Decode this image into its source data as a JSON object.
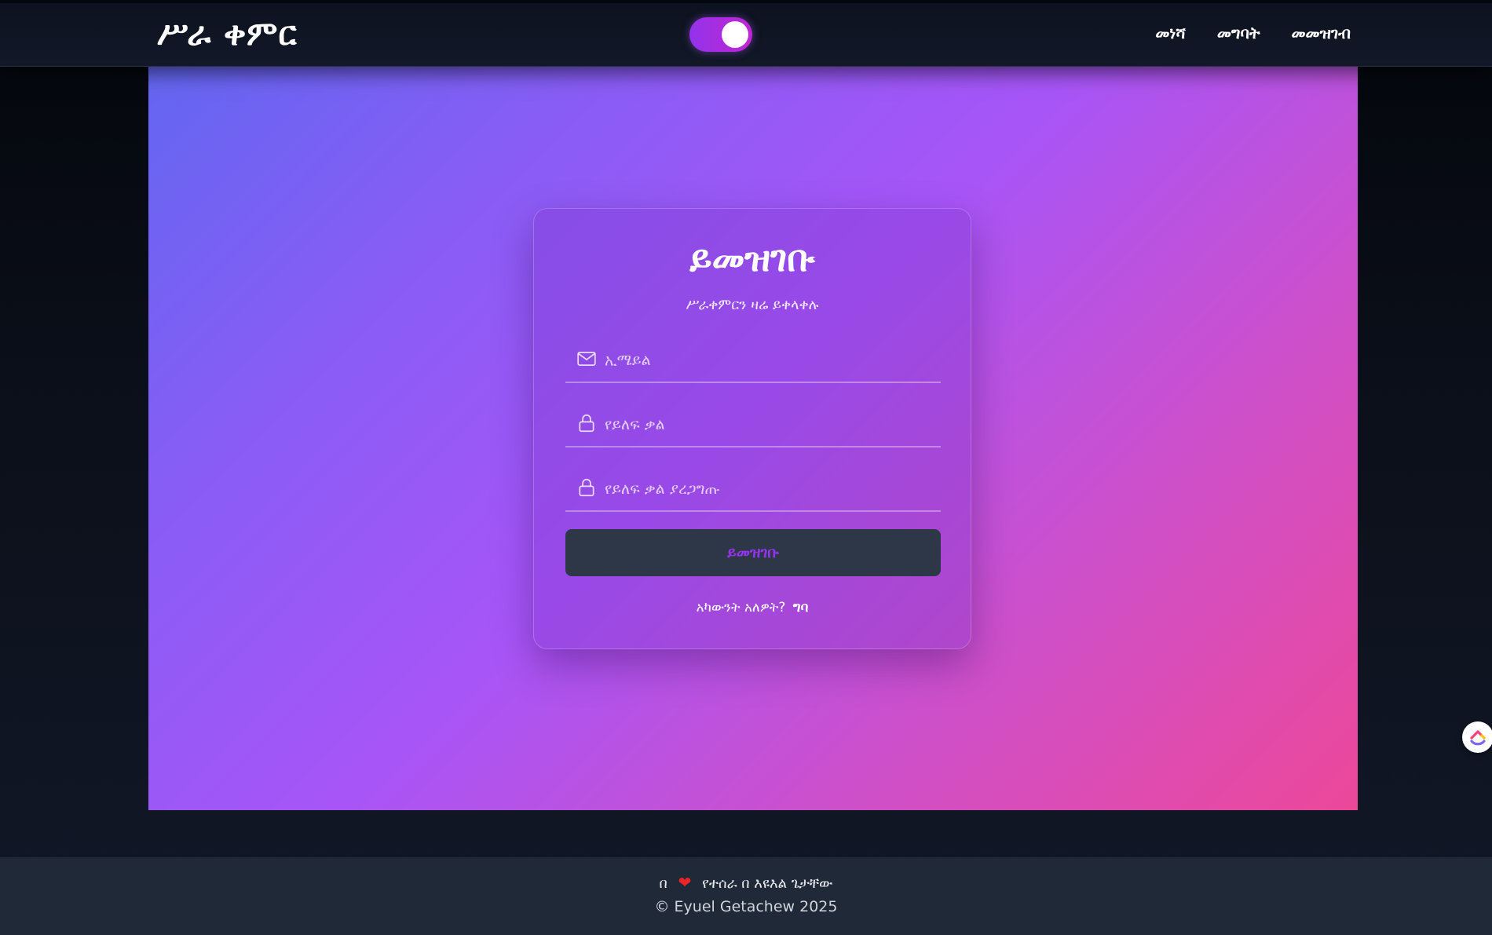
{
  "header": {
    "brand": "ሥራ ቀምር",
    "theme_toggle": {
      "state": "on"
    },
    "nav": [
      {
        "label": "መነሻ"
      },
      {
        "label": "መግባት"
      },
      {
        "label": "መመዝገብ"
      }
    ]
  },
  "form": {
    "title": "ይመዝገቡ",
    "subtitle": "ሥራቀምርን ዛሬ ይቀላቀሉ",
    "email": {
      "placeholder": "ኢሜይል",
      "value": "",
      "icon": "mail-icon"
    },
    "password": {
      "placeholder": "የይለፍ ቃል",
      "value": "",
      "icon": "lock-icon"
    },
    "confirm_password": {
      "placeholder": "የይለፍ ቃል ያረጋግጡ",
      "value": "",
      "icon": "lock-icon"
    },
    "submit_label": "ይመዝገቡ",
    "login_prompt": "አካውንት አለዎት?",
    "login_link": "ግባ"
  },
  "footer": {
    "made_prefix": "በ",
    "heart": "❤",
    "made_suffix": "የተሰራ በ እዩእል ጌታቸው",
    "copyright": "© Eyuel Getachew 2025"
  },
  "colors": {
    "accent": "#9333ea",
    "gradient_start": "#6366f1",
    "gradient_end": "#ec4899",
    "button_bg": "#2d3748"
  }
}
